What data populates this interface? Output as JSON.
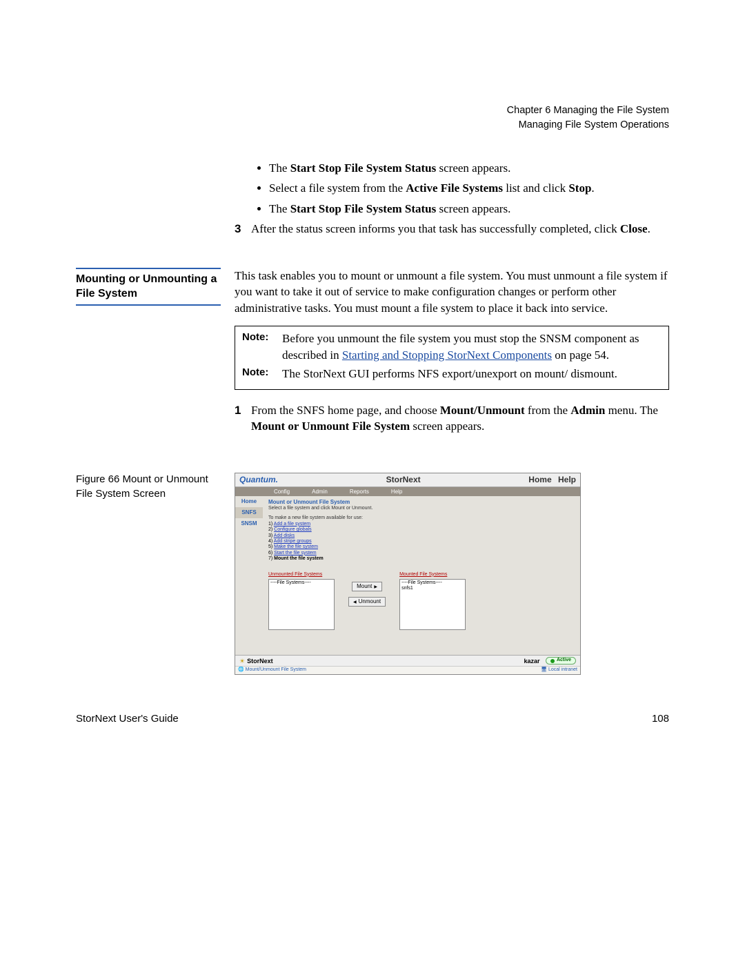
{
  "header": {
    "line1": "Chapter 6  Managing the File System",
    "line2": "Managing File System Operations"
  },
  "bullets1": {
    "b1a": "The ",
    "b1b": "Start Stop File System Status",
    "b1c": " screen appears.",
    "b2a": "Select a file system from the ",
    "b2b": "Active File Systems",
    "b2c": " list and click ",
    "b2d": "Stop",
    "b2e": ".",
    "b3a": "The ",
    "b3b": "Start Stop File System Status",
    "b3c": " screen appears."
  },
  "step_after_bullets": {
    "num": "3",
    "t1": "After the status screen informs you that task has successfully completed, click ",
    "t2": "Close",
    "t3": "."
  },
  "side_heading_1": "Mounting or Unmounting a File System",
  "intro_mount": "This task enables you to mount or unmount a file system. You must unmount a file system if you want to take it out of service to make configuration changes or perform other administrative tasks. You must mount a file system to place it back into service.",
  "notes": {
    "lbl": "Note:",
    "n1a": "Before you unmount the file system you must stop the SNSM component as described in ",
    "n1link": "Starting and Stopping StorNext Components",
    "n1b": " on page  54.",
    "n2": "The StorNext GUI performs NFS export/unexport on mount/ dismount."
  },
  "step1": {
    "num": "1",
    "t1": "From the SNFS home page, and choose ",
    "t2": "Mount/Unmount",
    "t3": " from the ",
    "t4": "Admin",
    "t5": " menu. The ",
    "t6": "Mount or Unmount File System",
    "t7": " screen appears."
  },
  "fig_caption": "Figure 66  Mount or Unmount File System Screen",
  "screenshot": {
    "brand": "Quantum.",
    "title": "StorNext",
    "home": "Home",
    "help": "Help",
    "menus": [
      "Config",
      "Admin",
      "Reports",
      "Help"
    ],
    "leftnav": [
      "Home",
      "SNFS",
      "SNSM"
    ],
    "panel_title": "Mount or Unmount File System",
    "panel_sub": "Select a file system and click Mount or Unmount.",
    "avail_intro": "To make a new file system available for use:",
    "steps": [
      {
        "n": "1) ",
        "lnk": "Add a file system"
      },
      {
        "n": "2) ",
        "lnk": "Configure globals"
      },
      {
        "n": "3) ",
        "lnk": "Add disks"
      },
      {
        "n": "4) ",
        "lnk": "Add stripe groups"
      },
      {
        "n": "5) ",
        "lnk": "Make the file system"
      },
      {
        "n": "6) ",
        "lnk": "Start the file system"
      },
      {
        "n": "7) ",
        "plain": "Mount the file system"
      }
    ],
    "left_box_cap": "Unmounted File Systems",
    "left_box_ph": "----File Systems----",
    "right_box_cap": "Mounted File Systems",
    "right_box_ph": "----File Systems----",
    "mounted_item": "snfs1",
    "btn_mount": "Mount",
    "btn_unmount": "Unmount",
    "foot_left": "StorNext",
    "foot_host": "kazar",
    "foot_pill": "Active",
    "status_left": "Mount/Unmount File System",
    "status_right": "Local intranet"
  },
  "footer": {
    "left": "StorNext User's Guide",
    "right": "108"
  }
}
